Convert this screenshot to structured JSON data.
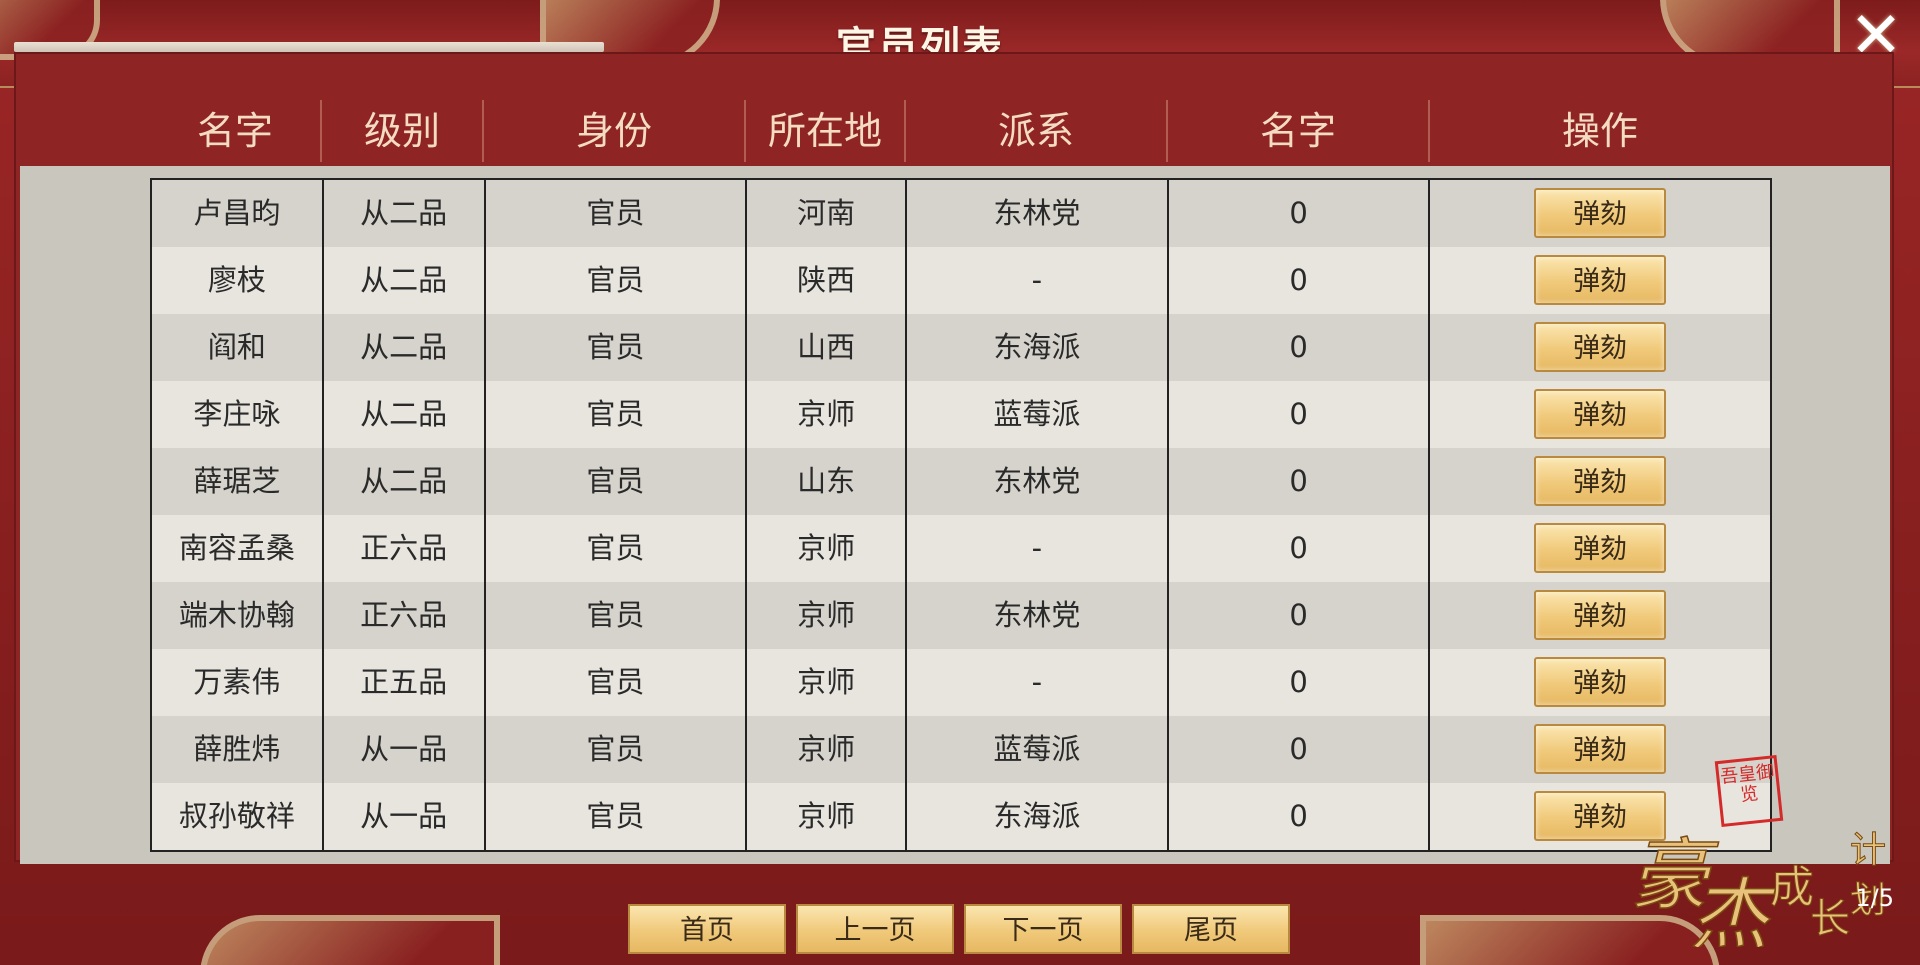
{
  "dialog": {
    "title": "官员列表",
    "close_icon": "close-icon"
  },
  "table": {
    "headers": [
      "名字",
      "级别",
      "身份",
      "所在地",
      "派系",
      "名字",
      "操作"
    ],
    "rows": [
      {
        "name": "卢昌昀",
        "rank": "从二品",
        "identity": "官员",
        "location": "河南",
        "faction": "东林党",
        "value": "0",
        "action": "弹劾"
      },
      {
        "name": "廖枝",
        "rank": "从二品",
        "identity": "官员",
        "location": "陕西",
        "faction": "-",
        "value": "0",
        "action": "弹劾"
      },
      {
        "name": "阎和",
        "rank": "从二品",
        "identity": "官员",
        "location": "山西",
        "faction": "东海派",
        "value": "0",
        "action": "弹劾"
      },
      {
        "name": "李庄咏",
        "rank": "从二品",
        "identity": "官员",
        "location": "京师",
        "faction": "蓝莓派",
        "value": "0",
        "action": "弹劾"
      },
      {
        "name": "薛琚芝",
        "rank": "从二品",
        "identity": "官员",
        "location": "山东",
        "faction": "东林党",
        "value": "0",
        "action": "弹劾"
      },
      {
        "name": "南容孟桑",
        "rank": "正六品",
        "identity": "官员",
        "location": "京师",
        "faction": "-",
        "value": "0",
        "action": "弹劾"
      },
      {
        "name": "端木协翰",
        "rank": "正六品",
        "identity": "官员",
        "location": "京师",
        "faction": "东林党",
        "value": "0",
        "action": "弹劾"
      },
      {
        "name": "万素伟",
        "rank": "正五品",
        "identity": "官员",
        "location": "京师",
        "faction": "-",
        "value": "0",
        "action": "弹劾"
      },
      {
        "name": "薛胜炜",
        "rank": "从一品",
        "identity": "官员",
        "location": "京师",
        "faction": "蓝莓派",
        "value": "0",
        "action": "弹劾"
      },
      {
        "name": "叔孙敬祥",
        "rank": "从一品",
        "identity": "官员",
        "location": "京师",
        "faction": "东海派",
        "value": "0",
        "action": "弹劾"
      }
    ]
  },
  "pager": {
    "first": "首页",
    "prev": "上一页",
    "next": "下一页",
    "last": "尾页",
    "page_indicator": "1/5"
  },
  "branding": {
    "logo_text": "豪杰成长计划",
    "seal_text": "吾皇御览"
  },
  "colors": {
    "frame_red": "#9c2626",
    "button_gold": "#f0c97a",
    "row_odd": "#d6d3cc",
    "row_even": "#e8e5df"
  }
}
